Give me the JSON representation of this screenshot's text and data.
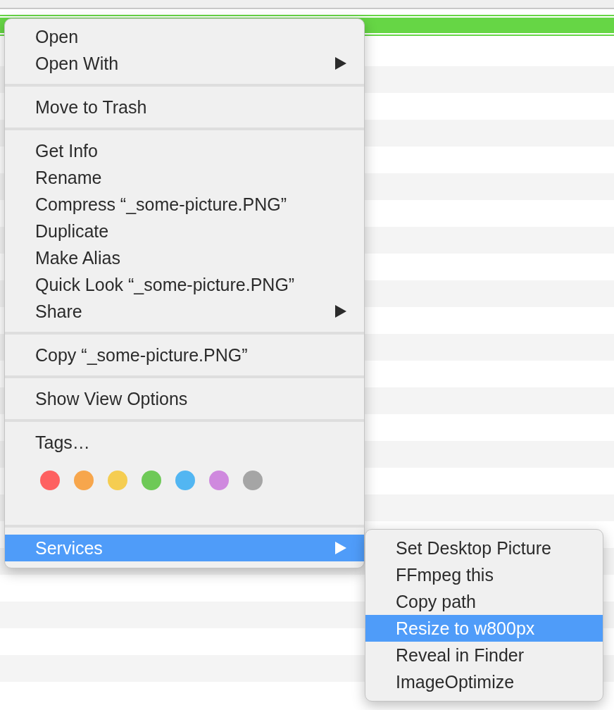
{
  "context_menu": {
    "entries": [
      {
        "kind": "item",
        "label": "Open",
        "has_submenu": false,
        "selected": false
      },
      {
        "kind": "item",
        "label": "Open With",
        "has_submenu": true,
        "selected": false
      },
      {
        "kind": "separator"
      },
      {
        "kind": "item",
        "label": "Move to Trash",
        "has_submenu": false,
        "selected": false
      },
      {
        "kind": "separator"
      },
      {
        "kind": "item",
        "label": "Get Info",
        "has_submenu": false,
        "selected": false
      },
      {
        "kind": "item",
        "label": "Rename",
        "has_submenu": false,
        "selected": false
      },
      {
        "kind": "item",
        "label": "Compress “_some-picture.PNG”",
        "has_submenu": false,
        "selected": false
      },
      {
        "kind": "item",
        "label": "Duplicate",
        "has_submenu": false,
        "selected": false
      },
      {
        "kind": "item",
        "label": "Make Alias",
        "has_submenu": false,
        "selected": false
      },
      {
        "kind": "item",
        "label": "Quick Look “_some-picture.PNG”",
        "has_submenu": false,
        "selected": false
      },
      {
        "kind": "item",
        "label": "Share",
        "has_submenu": true,
        "selected": false
      },
      {
        "kind": "separator"
      },
      {
        "kind": "item",
        "label": "Copy “_some-picture.PNG”",
        "has_submenu": false,
        "selected": false
      },
      {
        "kind": "separator"
      },
      {
        "kind": "item",
        "label": "Show View Options",
        "has_submenu": false,
        "selected": false
      },
      {
        "kind": "separator"
      },
      {
        "kind": "item",
        "label": "Tags…",
        "has_submenu": false,
        "selected": false
      },
      {
        "kind": "tags",
        "tags": [
          {
            "color": "#fe6161"
          },
          {
            "color": "#f7a64c"
          },
          {
            "color": "#f5cd51"
          },
          {
            "color": "#6ec957"
          },
          {
            "color": "#52b6f2"
          },
          {
            "color": "#cf89de"
          },
          {
            "color": "#a5a5a5"
          }
        ]
      },
      {
        "kind": "separator"
      },
      {
        "kind": "item",
        "label": "Services",
        "has_submenu": true,
        "selected": true
      }
    ]
  },
  "services_submenu": {
    "items": [
      {
        "label": "Set Desktop Picture",
        "selected": false
      },
      {
        "label": "FFmpeg this",
        "selected": false
      },
      {
        "label": "Copy path",
        "selected": false
      },
      {
        "label": "Resize to w800px",
        "selected": true
      },
      {
        "label": "Reveal in Finder",
        "selected": false
      },
      {
        "label": "ImageOptimize",
        "selected": false
      }
    ]
  }
}
